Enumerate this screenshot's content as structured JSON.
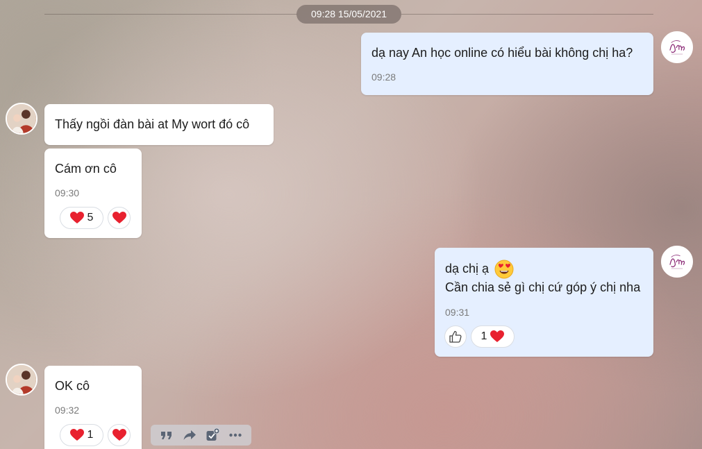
{
  "date_divider": "09:28 15/05/2021",
  "colors": {
    "outgoing_bubble": "#e5efff",
    "incoming_bubble": "#ffffff",
    "heart": "#e8212f"
  },
  "messages": [
    {
      "direction": "out",
      "text": "dạ nay An học online có hiểu bài không chị ha?",
      "time": "09:28"
    },
    {
      "direction": "in",
      "text": "Thấy ngồi đàn bài at My wort đó cô"
    },
    {
      "direction": "in",
      "text": "Cám ơn cô",
      "time": "09:30",
      "reaction_count": "5"
    },
    {
      "direction": "out",
      "lines": [
        "dạ chị ạ",
        "Cần chia sẻ gì chị cứ góp ý chị nha"
      ],
      "emoji": "heart-eyes-emoji",
      "time": "09:31",
      "reaction_count": "1"
    },
    {
      "direction": "in",
      "text": "OK cô",
      "time": "09:32",
      "reaction_count": "1"
    }
  ],
  "icons": {
    "reaction": "heart-icon",
    "like": "thumbs-up-icon",
    "toolbar": [
      "quote-icon",
      "forward-icon",
      "add-task-icon",
      "more-icon"
    ]
  }
}
